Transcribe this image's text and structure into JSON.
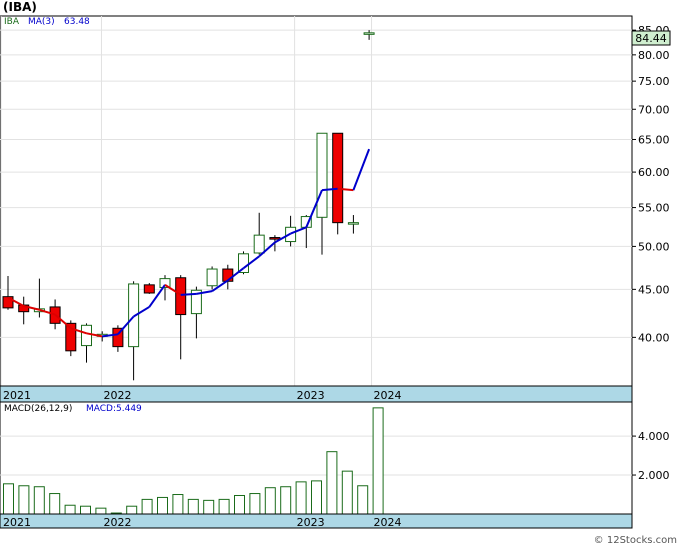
{
  "title": "(IBA)",
  "watermark": "© 12Stocks.com",
  "legend": {
    "symbol": "IBA",
    "ma_label": "MA(3)",
    "ma_value": "63.48",
    "macd_params": "MACD(26,12,9)",
    "macd_value_label": "MACD:5.449"
  },
  "colors": {
    "up_candle_fill": "#ffffff",
    "up_candle_stroke": "#1a6b1a",
    "down_candle": "#ee0000",
    "ma_rising": "#0000cc",
    "ma_falling": "#dd0000",
    "date_band": "#add8e6",
    "last_price_tag": "#cfeecf",
    "macd_bar_stroke": "#1a6b1a"
  },
  "chart_data": [
    {
      "type": "candlestick",
      "frequency": "quarterly",
      "y_scale": "log",
      "ylim": [
        35.5,
        88
      ],
      "y_ticks": [
        "40.00",
        "45.00",
        "50.00",
        "55.00",
        "60.00",
        "65.00",
        "70.00",
        "75.00",
        "80.00",
        "85.00"
      ],
      "x_tick_labels": [
        "2021",
        "2022",
        "2023",
        "2024"
      ],
      "last_price_label": "84.44",
      "candles": [
        {
          "o": 44.2,
          "h": 46.5,
          "l": 42.8,
          "c": 43.0
        },
        {
          "o": 43.3,
          "h": 44.2,
          "l": 41.3,
          "c": 42.6
        },
        {
          "o": 42.6,
          "h": 46.2,
          "l": 42.0,
          "c": 42.9
        },
        {
          "o": 43.1,
          "h": 43.9,
          "l": 40.8,
          "c": 41.4
        },
        {
          "o": 41.4,
          "h": 41.7,
          "l": 38.2,
          "c": 38.7
        },
        {
          "o": 39.2,
          "h": 41.4,
          "l": 37.6,
          "c": 41.2
        },
        {
          "o": 40.1,
          "h": 40.6,
          "l": 39.6,
          "c": 40.3
        },
        {
          "o": 40.9,
          "h": 41.2,
          "l": 38.6,
          "c": 39.1
        },
        {
          "o": 39.1,
          "h": 45.9,
          "l": 36.0,
          "c": 45.6
        },
        {
          "o": 45.5,
          "h": 45.7,
          "l": 44.5,
          "c": 44.6
        },
        {
          "o": 45.2,
          "h": 46.6,
          "l": 43.8,
          "c": 46.2
        },
        {
          "o": 46.3,
          "h": 46.6,
          "l": 37.9,
          "c": 42.3
        },
        {
          "o": 42.4,
          "h": 45.3,
          "l": 39.9,
          "c": 44.9
        },
        {
          "o": 45.4,
          "h": 47.6,
          "l": 45.0,
          "c": 47.3
        },
        {
          "o": 47.3,
          "h": 47.8,
          "l": 45.0,
          "c": 45.9
        },
        {
          "o": 46.9,
          "h": 49.4,
          "l": 46.7,
          "c": 49.1
        },
        {
          "o": 49.2,
          "h": 54.3,
          "l": 49.0,
          "c": 51.4
        },
        {
          "o": 51.1,
          "h": 51.4,
          "l": 49.4,
          "c": 50.9
        },
        {
          "o": 50.6,
          "h": 53.9,
          "l": 50.0,
          "c": 52.4
        },
        {
          "o": 52.4,
          "h": 54.0,
          "l": 49.8,
          "c": 53.8
        },
        {
          "o": 53.7,
          "h": 66.0,
          "l": 49.0,
          "c": 66.0
        },
        {
          "o": 66.0,
          "h": 66.0,
          "l": 51.5,
          "c": 53.0
        },
        {
          "o": 53.0,
          "h": 54.0,
          "l": 51.6,
          "c": 53.0
        },
        {
          "o": 84.2,
          "h": 85.0,
          "l": 83.0,
          "c": 84.44
        }
      ],
      "ma3": [
        {
          "i": 0,
          "v": 44.1
        },
        {
          "i": 1,
          "v": 43.2
        },
        {
          "i": 2,
          "v": 42.8
        },
        {
          "i": 3,
          "v": 42.3
        },
        {
          "i": 4,
          "v": 40.9
        },
        {
          "i": 5,
          "v": 40.4
        },
        {
          "i": 6,
          "v": 40.1
        },
        {
          "i": 7,
          "v": 40.3
        },
        {
          "i": 8,
          "v": 42.1
        },
        {
          "i": 9,
          "v": 43.1
        },
        {
          "i": 10,
          "v": 45.5
        },
        {
          "i": 11,
          "v": 44.4
        },
        {
          "i": 12,
          "v": 44.5
        },
        {
          "i": 13,
          "v": 44.8
        },
        {
          "i": 14,
          "v": 46.0
        },
        {
          "i": 15,
          "v": 47.4
        },
        {
          "i": 16,
          "v": 48.8
        },
        {
          "i": 17,
          "v": 50.5
        },
        {
          "i": 18,
          "v": 51.6
        },
        {
          "i": 19,
          "v": 52.4
        },
        {
          "i": 20,
          "v": 57.4
        },
        {
          "i": 21,
          "v": 57.6
        },
        {
          "i": 22,
          "v": 57.4
        },
        {
          "i": 23,
          "v": 63.48
        }
      ]
    },
    {
      "type": "bar",
      "title": "MACD(26,12,9)",
      "ylim": [
        0,
        5.75
      ],
      "y_ticks": [
        "2.000",
        "4.000"
      ],
      "x_tick_labels": [
        "2021",
        "2022",
        "2023",
        "2024"
      ],
      "values": [
        1.55,
        1.45,
        1.4,
        1.05,
        0.45,
        0.4,
        0.3,
        0.05,
        0.4,
        0.75,
        0.85,
        1.0,
        0.75,
        0.7,
        0.75,
        0.95,
        1.05,
        1.35,
        1.4,
        1.65,
        1.7,
        3.2,
        2.2,
        1.45,
        5.449
      ]
    }
  ]
}
